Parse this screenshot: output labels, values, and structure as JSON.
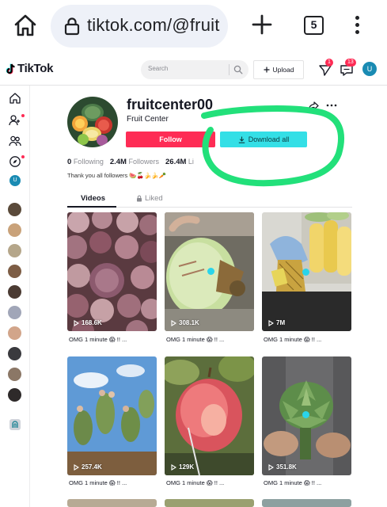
{
  "browser": {
    "url": "tiktok.com/@fruit",
    "tab_count": "5"
  },
  "header": {
    "logo_text": "TikTok",
    "search_placeholder": "Search",
    "upload_label": "Upload",
    "notif_badge": "1",
    "inbox_badge": "13",
    "user_initial": "U"
  },
  "sidebar": {
    "user_initial": "U"
  },
  "profile": {
    "username": "fruitcenter00",
    "nickname": "Fruit Center",
    "follow_label": "Follow",
    "download_label": "Download all",
    "following_count": "0",
    "following_label": "Following",
    "followers_count": "2.4M",
    "followers_label": "Followers",
    "likes_count": "26.4M",
    "likes_label": "Li",
    "bio": "Thank you all followers 🍉🍒🍌🍌🥕"
  },
  "tabs": {
    "videos": "Videos",
    "liked": "Liked"
  },
  "videos": [
    {
      "views": "168.6K",
      "caption": "OMG 1 minute 😱 !! ..."
    },
    {
      "views": "308.1K",
      "caption": "OMG 1 minute 😱 !! ..."
    },
    {
      "views": "7M",
      "caption": "OMG 1 minute 😱 !! ..."
    },
    {
      "views": "257.4K",
      "caption": "OMG 1 minute 😱 !! ..."
    },
    {
      "views": "129K",
      "caption": "OMG 1 minute 😱 !! ..."
    },
    {
      "views": "351.8K",
      "caption": "OMG 1 minute 😱 !! ..."
    }
  ],
  "colors": {
    "follow": "#fe2c55",
    "download": "#34dfe6",
    "annotation": "#22e07a"
  }
}
